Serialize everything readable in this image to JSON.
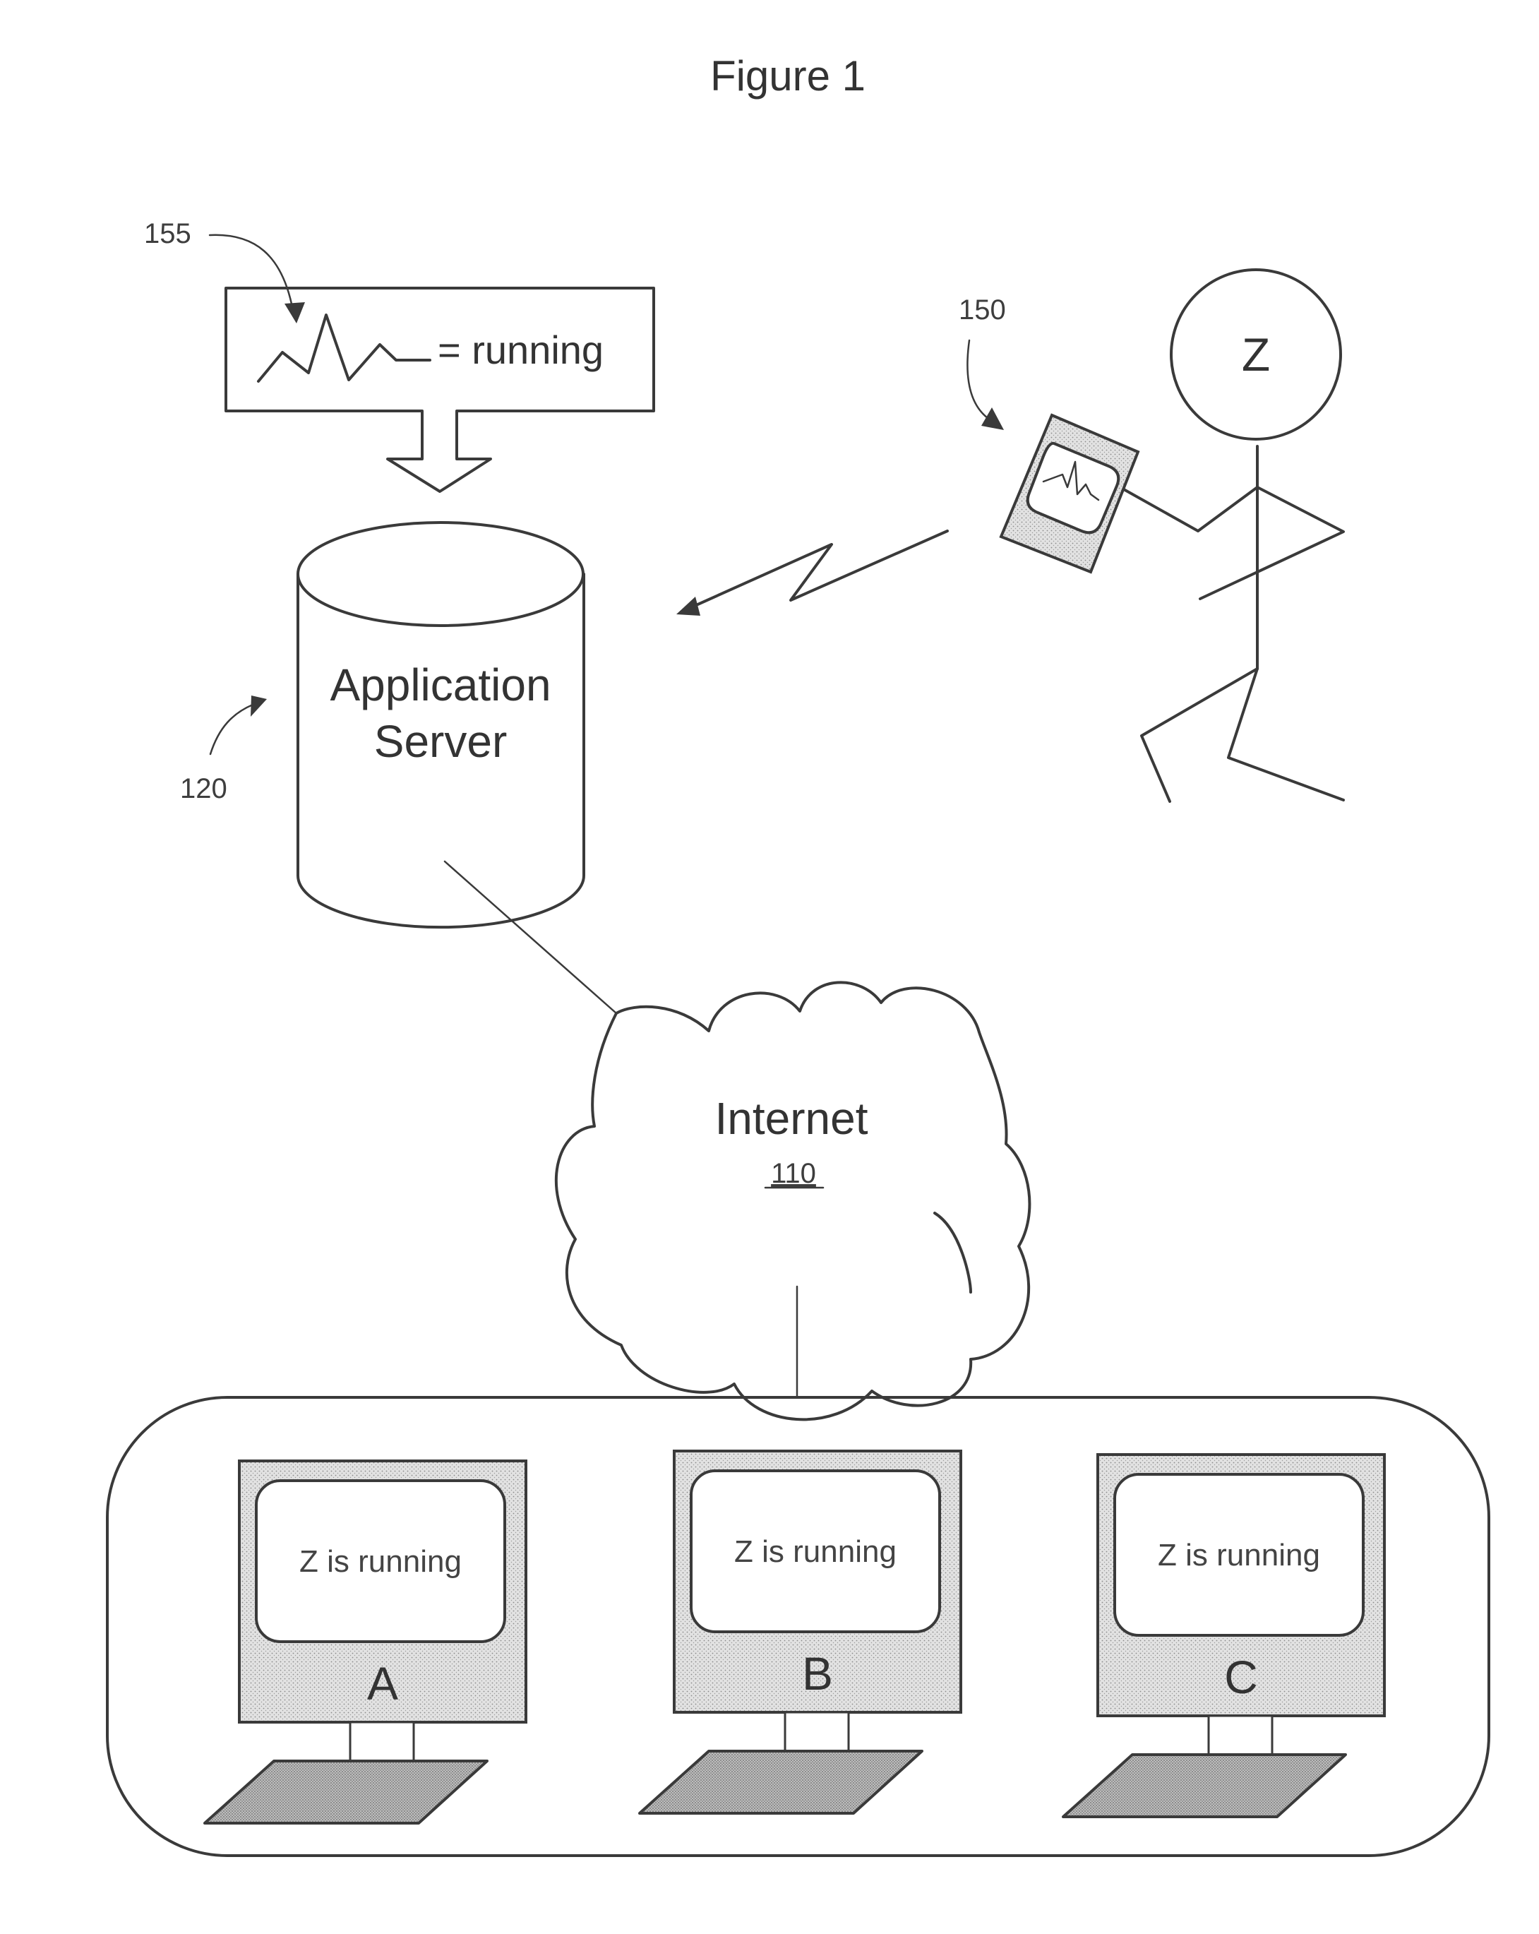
{
  "figure": {
    "title": "Figure 1"
  },
  "legend": {
    "ref_label": "155",
    "icon": "heartbeat-waveform-icon",
    "text": "= running"
  },
  "application_server": {
    "ref_label": "120",
    "line1": "Application",
    "line2": "Server"
  },
  "user": {
    "head_letter": "Z",
    "device_ref_label": "150",
    "device_icon": "heartbeat-waveform-icon",
    "signal_icon": "lightning-arrow-icon"
  },
  "internet": {
    "label": "Internet",
    "ref_label": "110"
  },
  "computers": [
    {
      "id": "A",
      "screen_text": "Z is running"
    },
    {
      "id": "B",
      "screen_text": "Z is running"
    },
    {
      "id": "C",
      "screen_text": "Z is running"
    }
  ],
  "colors": {
    "ink": "#3a3a3a",
    "shade": "#d6d6d6",
    "background": "#ffffff"
  }
}
